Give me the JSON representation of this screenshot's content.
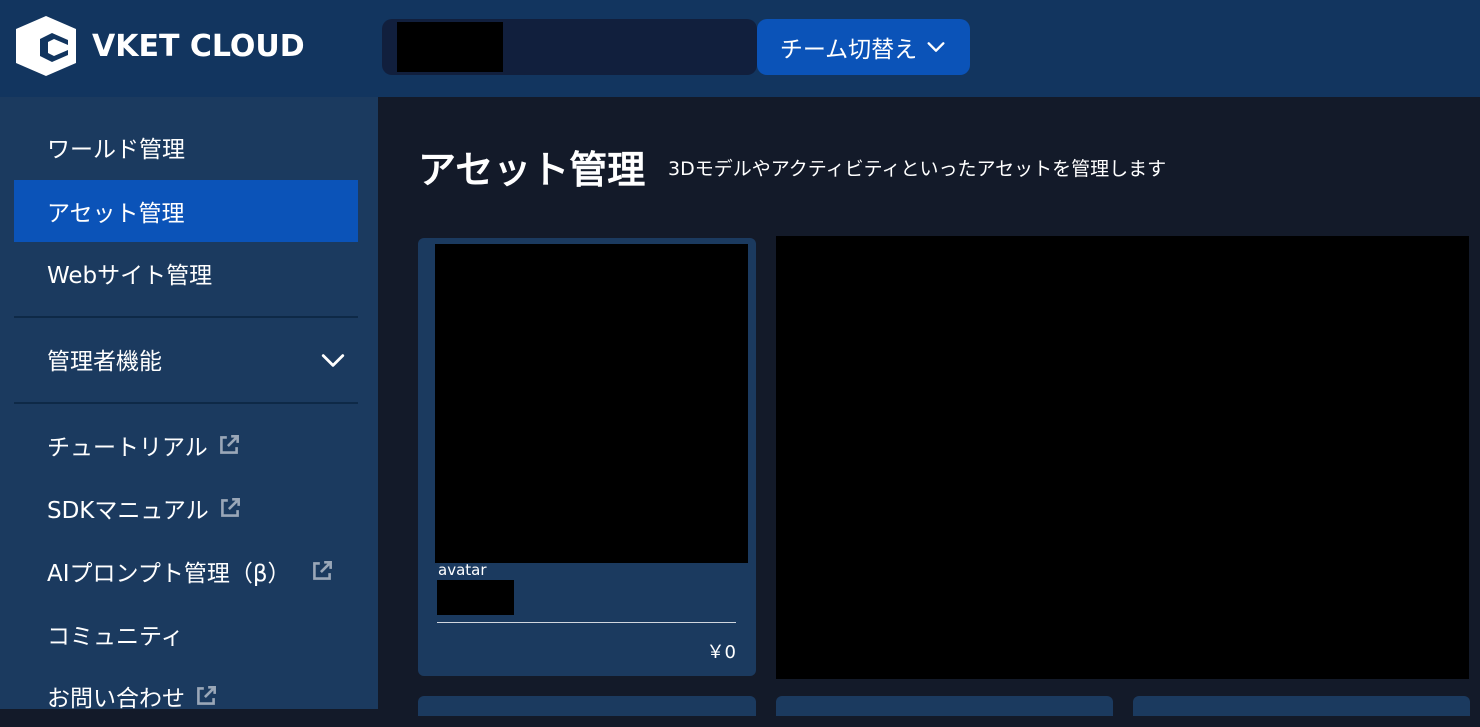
{
  "header": {
    "logo_text": "VKET CLOUD",
    "team_switch_label": "チーム切替え"
  },
  "sidebar": {
    "items": [
      {
        "label": "ワールド管理"
      },
      {
        "label": "アセット管理",
        "active": true
      },
      {
        "label": "Webサイト管理"
      },
      {
        "label": "管理者機能"
      },
      {
        "label": "チュートリアル"
      },
      {
        "label": "SDKマニュアル"
      },
      {
        "label": "AIプロンプト管理（β）"
      },
      {
        "label": "コミュニティ"
      },
      {
        "label": "お問い合わせ"
      }
    ]
  },
  "main": {
    "title": "アセット管理",
    "subtitle": "3Dモデルやアクティビティといったアセットを管理します",
    "asset_card": {
      "type": "avatar",
      "price": "￥0"
    }
  },
  "colors": {
    "header_bg": "#12355f",
    "sidebar_bg": "#1b3a5f",
    "main_bg": "#131a29",
    "accent": "#0b53b8"
  },
  "icons": {
    "external": "external-link-icon",
    "chevron": "chevron-down-icon"
  }
}
